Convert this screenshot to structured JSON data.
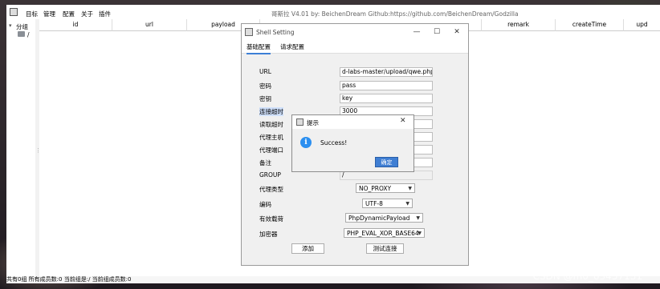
{
  "app": {
    "title": "哥斯拉   V4.01 by: BeichenDream Github:https://github.com/BeichenDream/Godzilla",
    "menu": [
      "目标",
      "管理",
      "配置",
      "关于",
      "插件"
    ],
    "tree": {
      "root": "分组",
      "child": "/"
    },
    "columns": [
      "id",
      "url",
      "payload",
      "",
      "remark",
      "createTime",
      "upd"
    ],
    "status": "共有0组 所有成员数:0 当前组是:/ 当前组成员数:0"
  },
  "shell_setting": {
    "title": "Shell Setting",
    "controls": {
      "minimize": "—",
      "maximize": "☐",
      "close": "✕"
    },
    "tabs": [
      "基础配置",
      "请求配置"
    ],
    "fields": [
      {
        "label": "URL",
        "value": "d-labs-master/upload/qwe.php"
      },
      {
        "label": "密码",
        "value": "pass"
      },
      {
        "label": "密钥",
        "value": "key"
      },
      {
        "label": "连接超时",
        "value": "3000"
      },
      {
        "label": "读取超时",
        "value": ""
      },
      {
        "label": "代理主机",
        "value": ""
      },
      {
        "label": "代理端口",
        "value": ""
      },
      {
        "label": "备注",
        "value": ""
      },
      {
        "label": "GROUP",
        "value": "/"
      }
    ],
    "selects": [
      {
        "label": "代理类型",
        "value": "NO_PROXY"
      },
      {
        "label": "编码",
        "value": "UTF-8"
      },
      {
        "label": "有效载荷",
        "value": "PhpDynamicPayload"
      },
      {
        "label": "加密器",
        "value": "PHP_EVAL_XOR_BASE64"
      }
    ],
    "buttons": {
      "add": "添加",
      "test": "测试连接"
    }
  },
  "tip_dialog": {
    "title": "提示",
    "close": "✕",
    "message": "Success!",
    "icon": "info-icon",
    "ok": "确定"
  },
  "watermark": "CSDN @m0_63457131",
  "colors": {
    "accent": "#3f7ed3",
    "info": "#2b8ff0",
    "selection": "#cfe0fb"
  }
}
